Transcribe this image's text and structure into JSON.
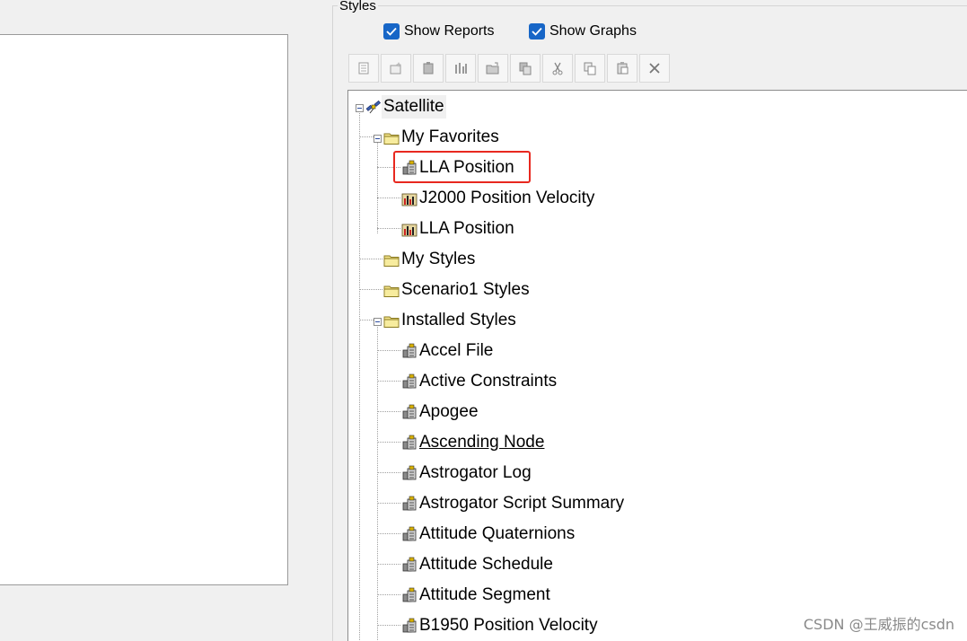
{
  "group": {
    "title": "Styles"
  },
  "options": {
    "show_reports": "Show Reports",
    "show_graphs": "Show Graphs",
    "accent": "#1766c7"
  },
  "toolbar": {
    "buttons": [
      {
        "icon": "new-report-icon"
      },
      {
        "icon": "new-graph-icon"
      },
      {
        "icon": "properties-icon"
      },
      {
        "icon": "chart-properties-icon"
      },
      {
        "icon": "open-icon"
      },
      {
        "icon": "duplicate-icon"
      },
      {
        "icon": "cut-icon"
      },
      {
        "icon": "copy-icon"
      },
      {
        "icon": "paste-icon"
      },
      {
        "icon": "delete-icon"
      }
    ]
  },
  "tree": {
    "root": "Satellite",
    "my_favorites": {
      "label": "My Favorites",
      "items": [
        "LLA Position",
        "J2000 Position Velocity",
        "LLA Position"
      ]
    },
    "my_styles": "My Styles",
    "scenario_styles": "Scenario1 Styles",
    "installed": {
      "label": "Installed Styles",
      "items": [
        "Accel File",
        "Active Constraints",
        "Apogee",
        "Ascending Node",
        "Astrogator Log",
        "Astrogator Script Summary",
        "Attitude Quaternions",
        "Attitude Schedule",
        "Attitude Segment",
        "B1950 Position Velocity"
      ]
    },
    "highlight_color": "#e8281f"
  },
  "watermark": "CSDN @王威振的csdn"
}
